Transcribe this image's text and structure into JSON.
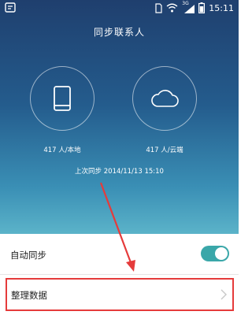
{
  "status_bar": {
    "network": "3G",
    "time": "15:11",
    "icons": [
      "app-notification-icon",
      "sim-icon",
      "wifi-icon",
      "signal-icon",
      "battery-icon"
    ]
  },
  "header": {
    "title": "同步联系人"
  },
  "sync_status": {
    "local": {
      "icon": "phone-icon",
      "count_label": "417 人/本地"
    },
    "cloud": {
      "icon": "cloud-icon",
      "count_label": "417 人/云端"
    },
    "last_sync": "上次同步 2014/11/13 15:10"
  },
  "settings": {
    "auto_sync": {
      "label": "自动同步",
      "enabled": true
    },
    "organize": {
      "label": "整理数据",
      "icon": "chevron-right-icon"
    }
  },
  "colors": {
    "header_gradient_top": "#1f3f6e",
    "header_gradient_bottom": "#5bb3c9",
    "toggle_on": "#3aa7a9",
    "highlight_red": "#e53b3b"
  }
}
